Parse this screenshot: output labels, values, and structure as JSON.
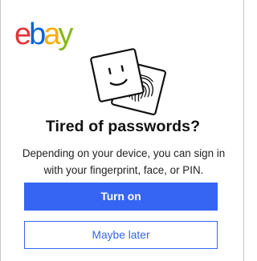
{
  "brand": {
    "logo_text": "ebay",
    "logo_colors": [
      "#e53238",
      "#0064d2",
      "#f5af02",
      "#86b817"
    ]
  },
  "illustration": {
    "icons": [
      "smiley-face-icon",
      "fingerprint-icon"
    ]
  },
  "prompt": {
    "title": "Tired of passwords?",
    "description": "Depending on your device, you can sign in with your fingerprint, face, or PIN."
  },
  "actions": {
    "primary_label": "Turn on",
    "secondary_label": "Maybe later",
    "accent_color": "#3665f3"
  }
}
